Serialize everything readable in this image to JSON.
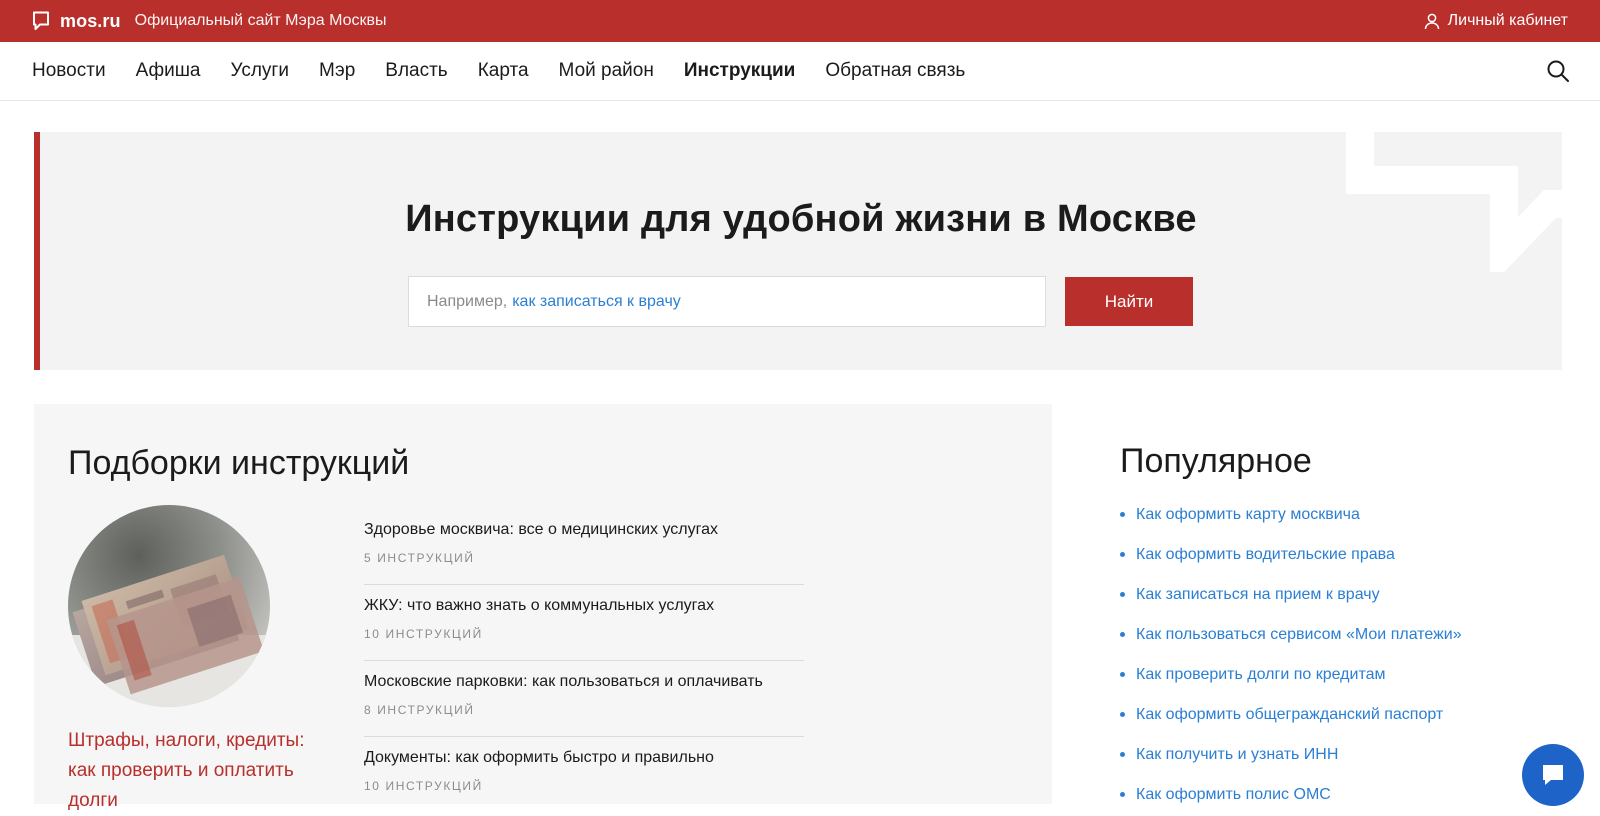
{
  "topbar": {
    "brand_name": "mos.ru",
    "tagline": "Официальный сайт Мэра Москвы",
    "account_label": "Личный кабинет",
    "color": "#b82f2c"
  },
  "nav": {
    "items": [
      {
        "label": "Новости",
        "active": false
      },
      {
        "label": "Афиша",
        "active": false
      },
      {
        "label": "Услуги",
        "active": false
      },
      {
        "label": "Мэр",
        "active": false
      },
      {
        "label": "Власть",
        "active": false
      },
      {
        "label": "Карта",
        "active": false
      },
      {
        "label": "Мой район",
        "active": false
      },
      {
        "label": "Инструкции",
        "active": true
      },
      {
        "label": "Обратная связь",
        "active": false
      }
    ],
    "search_icon": "search-icon"
  },
  "hero": {
    "title": "Инструкции для удобной жизни в Москве",
    "search_prefix": "Например,",
    "search_example": "как записаться к врачу",
    "search_button": "Найти"
  },
  "collections": {
    "title": "Подборки инструкций",
    "featured_image": "money-banknotes-photo",
    "featured_link": "Штрафы, налоги, кредиты: как проверить и оплатить долги",
    "items": [
      {
        "name": "Здоровье москвича: все о медицинских услугах",
        "count": "5 ИНСТРУКЦИЙ"
      },
      {
        "name": "ЖКУ: что важно знать о коммунальных услугах",
        "count": "10 ИНСТРУКЦИЙ"
      },
      {
        "name": "Московские парковки: как пользоваться и оплачивать",
        "count": "8 ИНСТРУКЦИЙ"
      },
      {
        "name": "Документы: как оформить быстро и правильно",
        "count": "10 ИНСТРУКЦИЙ"
      }
    ]
  },
  "popular": {
    "title": "Популярное",
    "items": [
      "Как оформить карту москвича",
      "Как оформить водительские права",
      "Как записаться на прием к врачу",
      "Как пользоваться сервисом «Мои платежи»",
      "Как проверить долги по кредитам",
      "Как оформить общегражданский паспорт",
      "Как получить и узнать ИНН",
      "Как оформить полис ОМС"
    ]
  },
  "chat": {
    "icon": "chat-icon",
    "color": "#1e64c8"
  }
}
